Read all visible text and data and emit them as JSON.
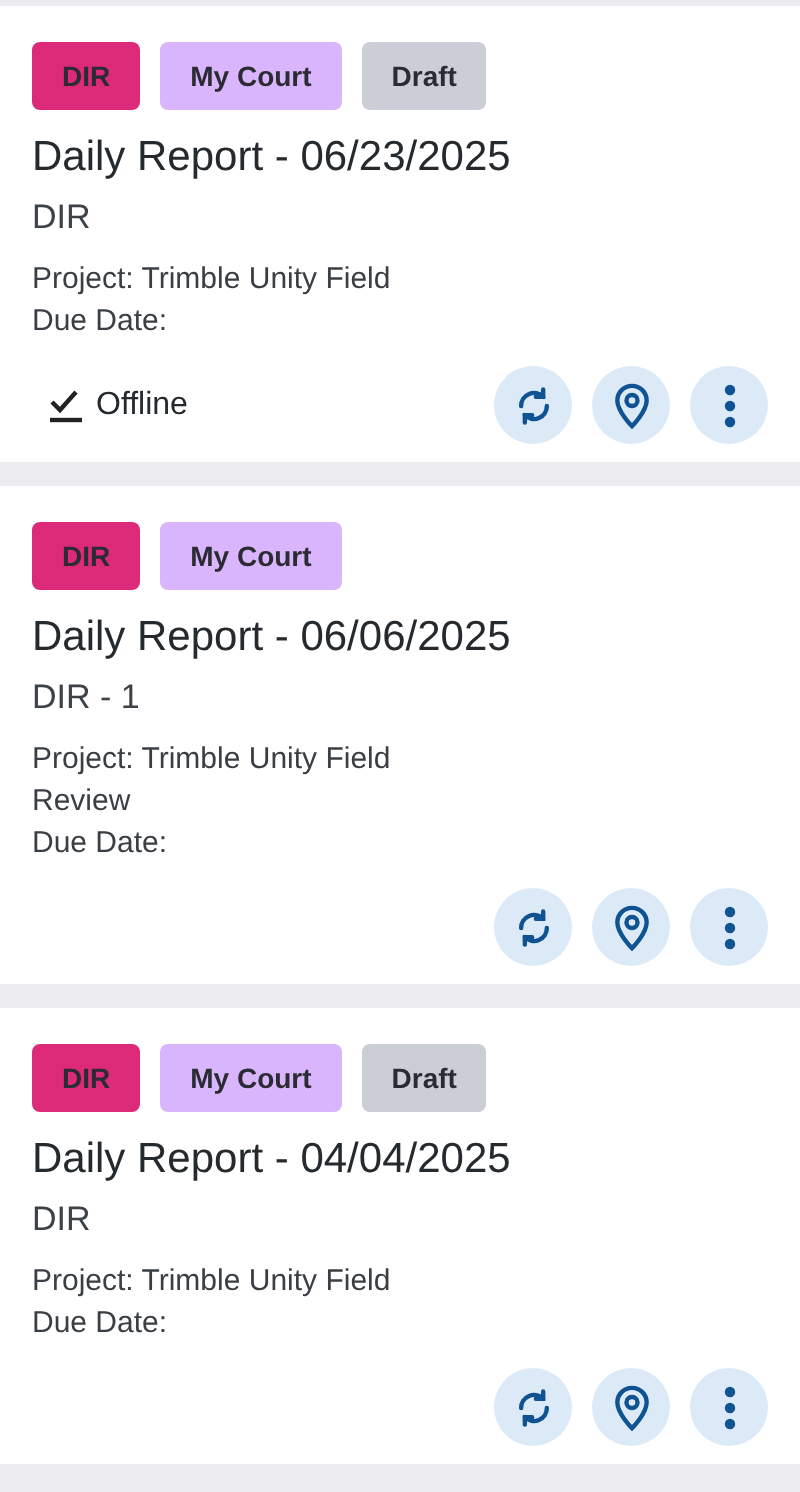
{
  "reports": [
    {
      "tags": [
        {
          "label": "DIR",
          "color": "#dd2a78"
        },
        {
          "label": "My Court",
          "color": "#d9b5fd"
        },
        {
          "label": "Draft",
          "color": "#cbced6"
        }
      ],
      "title": "Daily Report - 06/23/2025",
      "subtitle": "DIR",
      "lines": [
        "Project: Trimble Unity Field",
        "Due Date:"
      ],
      "status": {
        "label": "Offline",
        "checked": true
      }
    },
    {
      "tags": [
        {
          "label": "DIR",
          "color": "#dd2a78"
        },
        {
          "label": "My Court",
          "color": "#d9b5fd"
        }
      ],
      "title": "Daily Report - 06/06/2025",
      "subtitle": "DIR - 1",
      "lines": [
        "Project: Trimble Unity Field",
        "Review",
        "Due Date:"
      ]
    },
    {
      "tags": [
        {
          "label": "DIR",
          "color": "#dd2a78"
        },
        {
          "label": "My Court",
          "color": "#d9b5fd"
        },
        {
          "label": "Draft",
          "color": "#cbced6"
        }
      ],
      "title": "Daily Report - 04/04/2025",
      "subtitle": "DIR",
      "lines": [
        "Project: Trimble Unity Field",
        "Due Date:"
      ]
    }
  ]
}
